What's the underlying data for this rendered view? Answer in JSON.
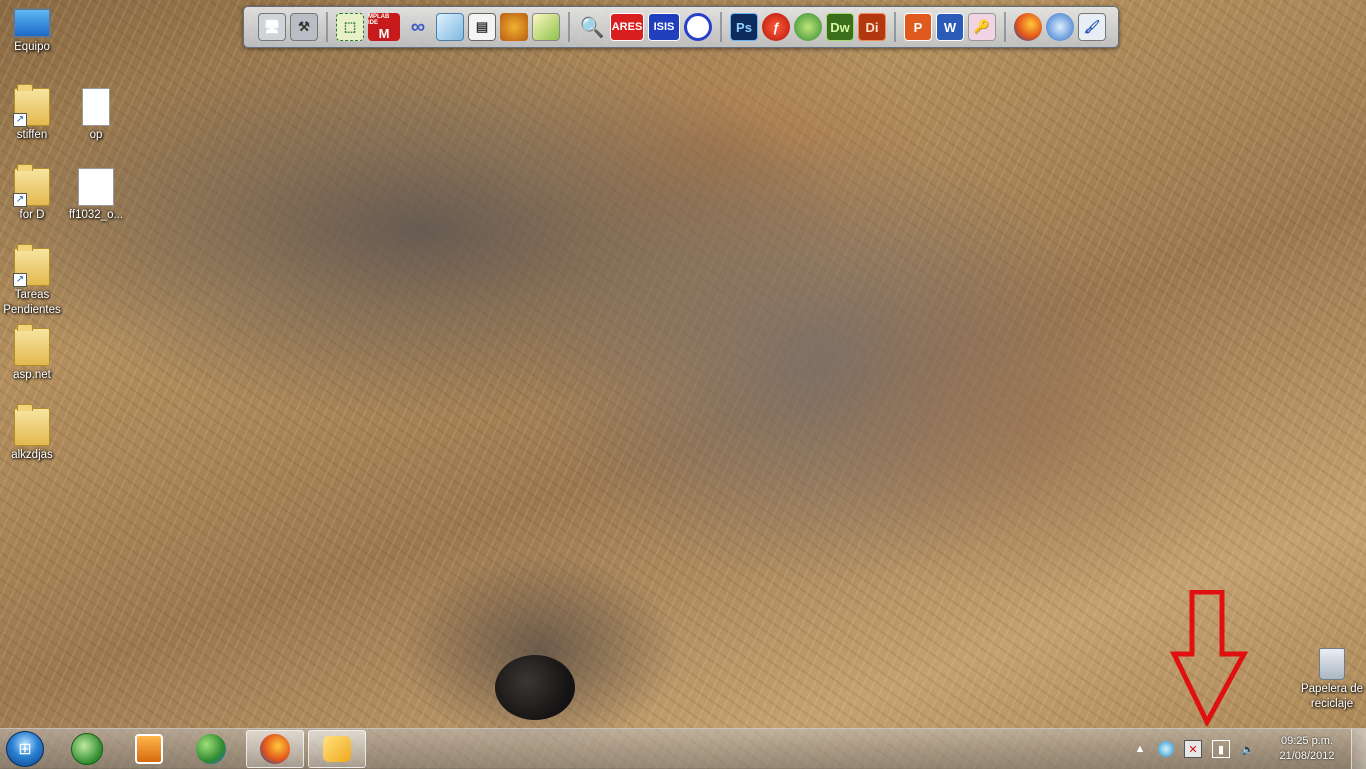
{
  "desktop": {
    "icons": [
      {
        "label": "Equipo"
      },
      {
        "label": "stiffen"
      },
      {
        "label": "op"
      },
      {
        "label": "for D"
      },
      {
        "label": "ff1032_o..."
      },
      {
        "label": "Tareas Pendientes"
      },
      {
        "label": "asp.net"
      },
      {
        "label": "alkzdjas"
      },
      {
        "label": "Papelera de reciclaje"
      }
    ]
  },
  "dock": {
    "icons": [
      {
        "name": "remote-desktop-icon",
        "text": ""
      },
      {
        "name": "tools-icon",
        "text": ""
      },
      {
        "name": "selection-tool-icon",
        "text": ""
      },
      {
        "name": "microchip-mplab-icon",
        "text": "MPLAB IDE"
      },
      {
        "name": "link-icon",
        "text": ""
      },
      {
        "name": "cube-icon",
        "text": ""
      },
      {
        "name": "window-app-icon",
        "text": ""
      },
      {
        "name": "spartan-helmet-icon",
        "text": ""
      },
      {
        "name": "image-editor-icon",
        "text": ""
      },
      {
        "name": "magnifier-icon",
        "text": ""
      },
      {
        "name": "ares-icon",
        "text": "ARES"
      },
      {
        "name": "isis-icon",
        "text": "ISIS"
      },
      {
        "name": "proteus-icon",
        "text": ""
      },
      {
        "name": "photoshop-icon",
        "text": "Ps"
      },
      {
        "name": "flash-icon",
        "text": ""
      },
      {
        "name": "globe-tool-icon",
        "text": ""
      },
      {
        "name": "dreamweaver-icon",
        "text": "Dw"
      },
      {
        "name": "director-icon",
        "text": "Di"
      },
      {
        "name": "powerpoint-icon",
        "text": ""
      },
      {
        "name": "word-icon",
        "text": ""
      },
      {
        "name": "key-icon",
        "text": ""
      },
      {
        "name": "firefox-icon",
        "text": ""
      },
      {
        "name": "google-earth-icon",
        "text": ""
      },
      {
        "name": "paint-icon",
        "text": ""
      }
    ]
  },
  "taskbar": {
    "clock": {
      "time": "09:25 p.m.",
      "date": "21/08/2012"
    }
  },
  "colors": {
    "arrow": "#e01010",
    "photoshop": "#0d2b5c",
    "dreamweaver": "#3b6e1a",
    "director": "#b3370f"
  }
}
